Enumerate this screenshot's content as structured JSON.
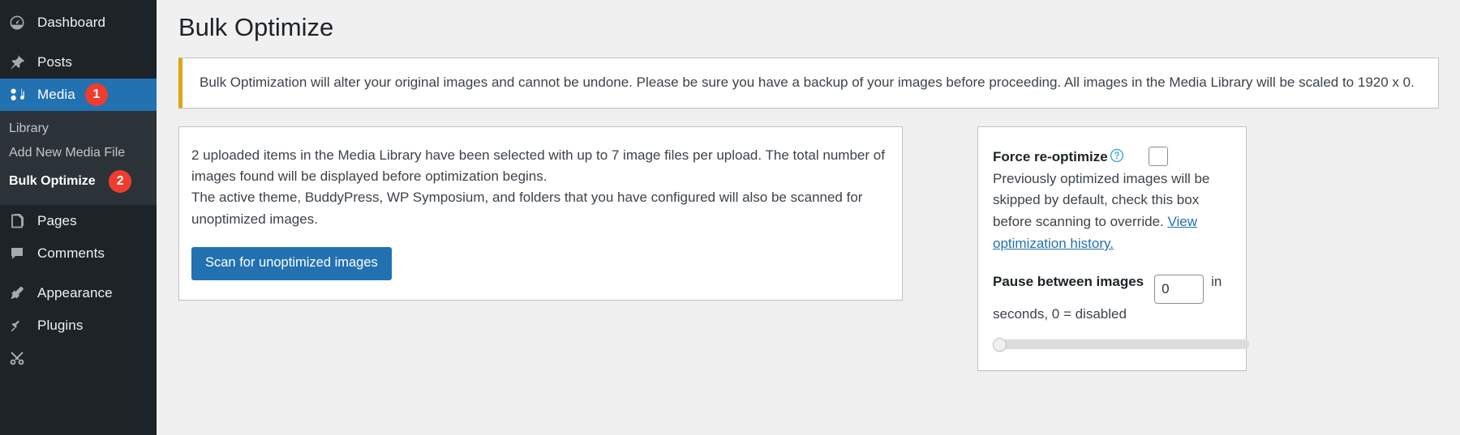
{
  "sidebar": {
    "items": [
      {
        "label": "Dashboard",
        "icon": "dashboard-icon",
        "current": false,
        "badge": null
      },
      {
        "label": "Posts",
        "icon": "pin-icon",
        "current": false,
        "badge": null
      },
      {
        "label": "Media",
        "icon": "media-icon",
        "current": true,
        "badge": "1"
      },
      {
        "label": "Pages",
        "icon": "pages-icon",
        "current": false,
        "badge": null
      },
      {
        "label": "Comments",
        "icon": "comments-icon",
        "current": false,
        "badge": null
      },
      {
        "label": "Appearance",
        "icon": "appearance-icon",
        "current": false,
        "badge": null
      },
      {
        "label": "Plugins",
        "icon": "plugins-icon",
        "current": false,
        "badge": null
      }
    ],
    "submenu": [
      {
        "label": "Library",
        "current": false,
        "badge": null
      },
      {
        "label": "Add New Media File",
        "current": false,
        "badge": null
      },
      {
        "label": "Bulk Optimize",
        "current": true,
        "badge": "2"
      }
    ]
  },
  "header": {
    "title": "Bulk Optimize"
  },
  "notice": {
    "text": "Bulk Optimization will alter your original images and cannot be undone. Please be sure you have a backup of your images before proceeding. All images in the Media Library will be scaled to 1920 x 0."
  },
  "main_card": {
    "line1": "2 uploaded items in the Media Library have been selected with up to 7 image files per upload. The total number of images found will be displayed before optimization begins.",
    "line2": "The active theme, BuddyPress, WP Symposium, and folders that you have configured will also be scanned for unoptimized images.",
    "scan_button": "Scan for unoptimized images"
  },
  "side_panel": {
    "force_label": "Force re-optimize",
    "help_icon": "help-icon",
    "checkbox_checked": false,
    "force_description_a": "Previously optimized images will be skipped by default, check this box before scanning to override.",
    "history_link": "View optimization history.",
    "pause_label": "Pause between images",
    "pause_value": "0",
    "pause_unit": "in",
    "pause_description": "seconds, 0 = disabled",
    "slider_value": 0
  },
  "colors": {
    "sidebar_bg": "#1d2327",
    "sidebar_submenu_bg": "#2c3338",
    "accent_blue": "#2271b1",
    "badge_red": "#f03c2e",
    "notice_border": "#dba617",
    "page_bg": "#f0f0f1"
  }
}
